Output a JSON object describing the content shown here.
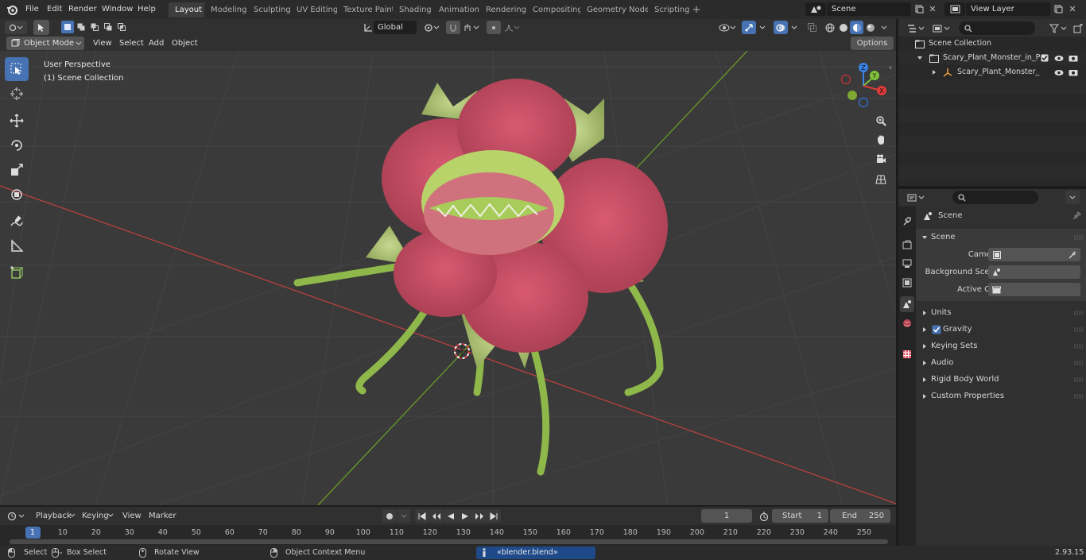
{
  "menu": [
    "File",
    "Edit",
    "Render",
    "Window",
    "Help"
  ],
  "workspaces": [
    "Layout",
    "Modeling",
    "Sculpting",
    "UV Editing",
    "Texture Paint",
    "Shading",
    "Animation",
    "Rendering",
    "Compositing",
    "Geometry Nodes",
    "Scripting"
  ],
  "scene_field": "Scene",
  "view_layer_field": "View Layer",
  "viewport_header": {
    "mode": "Object Mode",
    "items": [
      "View",
      "Select",
      "Add",
      "Object"
    ],
    "transform_orientation": "Global",
    "options": "Options"
  },
  "viewport": {
    "perspective_label": "User Perspective",
    "collection_label": "(1) Scene Collection",
    "gizmo": {
      "z": "Z",
      "y": "Y",
      "x": "X"
    }
  },
  "outliner": {
    "root": "Scene Collection",
    "collection": "Scary_Plant_Monster_in_Pot_(",
    "object": "Scary_Plant_Monster_in_I"
  },
  "properties": {
    "header": "Scene",
    "panel": "Scene",
    "camera_label": "Camera",
    "background_scene_label": "Background Scene",
    "active_clip_label": "Active Clip",
    "sections": [
      "Units",
      "Gravity",
      "Keying Sets",
      "Audio",
      "Rigid Body World",
      "Custom Properties"
    ]
  },
  "timeline": {
    "menus": [
      "Playback",
      "Keying",
      "View",
      "Marker"
    ],
    "current_frame": "1",
    "start_label": "Start",
    "start_value": "1",
    "end_label": "End",
    "end_value": "250",
    "ticks": [
      "1",
      "10",
      "20",
      "30",
      "40",
      "50",
      "60",
      "70",
      "80",
      "90",
      "100",
      "110",
      "120",
      "130",
      "140",
      "150",
      "160",
      "170",
      "180",
      "190",
      "200",
      "210",
      "220",
      "230",
      "240",
      "250"
    ]
  },
  "statusbar": {
    "select": "Select",
    "box_select": "Box Select",
    "rotate_view": "Rotate View",
    "context_menu": "Object Context Menu",
    "message": "«blender.blend» сохранено",
    "version": "2.93.15"
  },
  "colors": {
    "accent": "#4772b3",
    "x_axis": "#c0393f",
    "y_axis": "#6a9a28",
    "gizmo_x": "#e23a3a",
    "gizmo_y": "#7ec13a",
    "gizmo_z": "#3b82e6"
  }
}
